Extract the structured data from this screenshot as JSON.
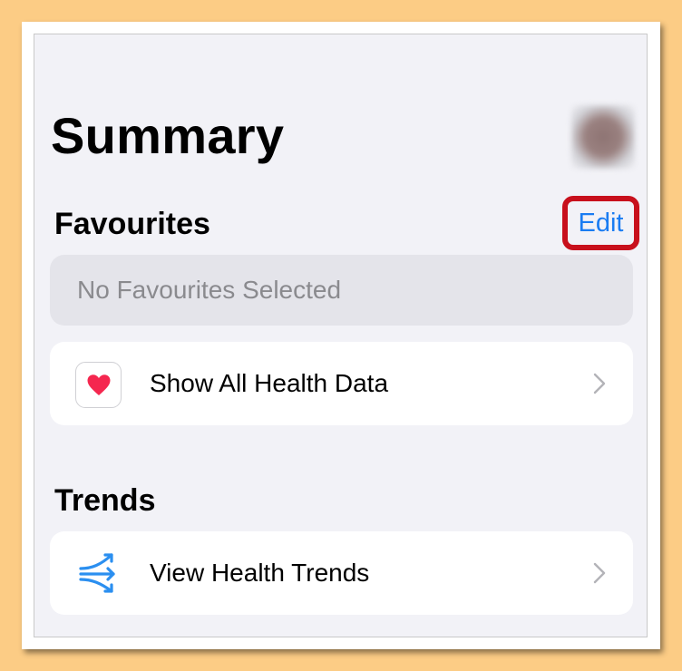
{
  "summary": {
    "title": "Summary"
  },
  "favourites": {
    "heading": "Favourites",
    "edit_label": "Edit",
    "empty_text": "No Favourites Selected",
    "show_all_label": "Show All Health Data",
    "show_all_icon": "heart-icon"
  },
  "trends": {
    "heading": "Trends",
    "view_label": "View Health Trends",
    "view_icon": "trends-arrows-icon"
  },
  "colors": {
    "background": "#fccc85",
    "screen": "#f2f2f7",
    "accent": "#1a7cf2",
    "heart": "#f5274f",
    "highlight": "#c8101c"
  }
}
